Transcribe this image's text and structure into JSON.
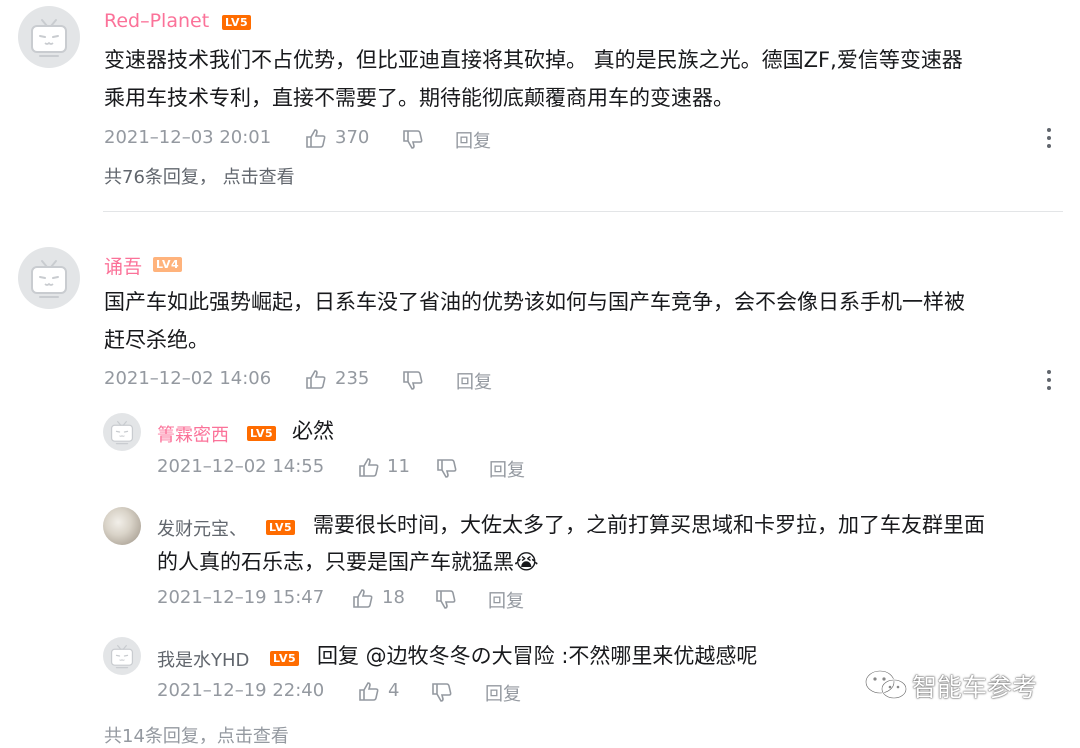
{
  "comments": [
    {
      "user": "Red–Planet",
      "level": "LV5",
      "text_line1": "变速器技术我们不占优势，但比亚迪直接将其砍掉。 真的是民族之光。德国ZF,爱信等变速器",
      "text_line2": "乘用车技术专利，直接不需要了。期待能彻底颠覆商用车的变速器。",
      "date": "2021–12–03 20:01",
      "likes": "370",
      "reply_label": "回复",
      "sub_replies": "共76条回复，",
      "sub_link": "点击查看"
    },
    {
      "user": "诵吾",
      "level": "LV4",
      "text_line1": "国产车如此强势崛起，日系车没了省油的优势该如何与国产车竞争，会不会像日系手机一样被",
      "text_line2": "赶尽杀绝。",
      "date": "2021–12–02 14:06",
      "likes": "235",
      "reply_label": "回复",
      "replies": [
        {
          "user": "箐霖密西",
          "level": "LV5",
          "text": "必然",
          "date": "2021–12–02 14:55",
          "likes": "11",
          "reply_label": "回复"
        },
        {
          "user": "发财元宝、",
          "level": "LV5",
          "text_line1": "需要很长时间，大佐太多了，之前打算买思域和卡罗拉，加了车友群里面",
          "text_line2": "的人真的石乐志，只要是国产车就猛黑",
          "emoji": "😭",
          "date": "2021–12–19 15:47",
          "likes": "18",
          "reply_label": "回复"
        },
        {
          "user": "我是水YHD",
          "level": "LV5",
          "text": "回复 @边牧冬冬の大冒险 :不然哪里来优越感呢",
          "date": "2021–12–19 22:40",
          "likes": "4",
          "reply_label": "回复"
        }
      ],
      "sub_replies_partial": "共14条回复，点击查看"
    }
  ],
  "watermark": "智能车参考",
  "colors": {
    "username_vip": "#fb7299",
    "meta_gray": "#9499a0",
    "level5": "#ff6c00",
    "level4": "#ffb37c"
  }
}
